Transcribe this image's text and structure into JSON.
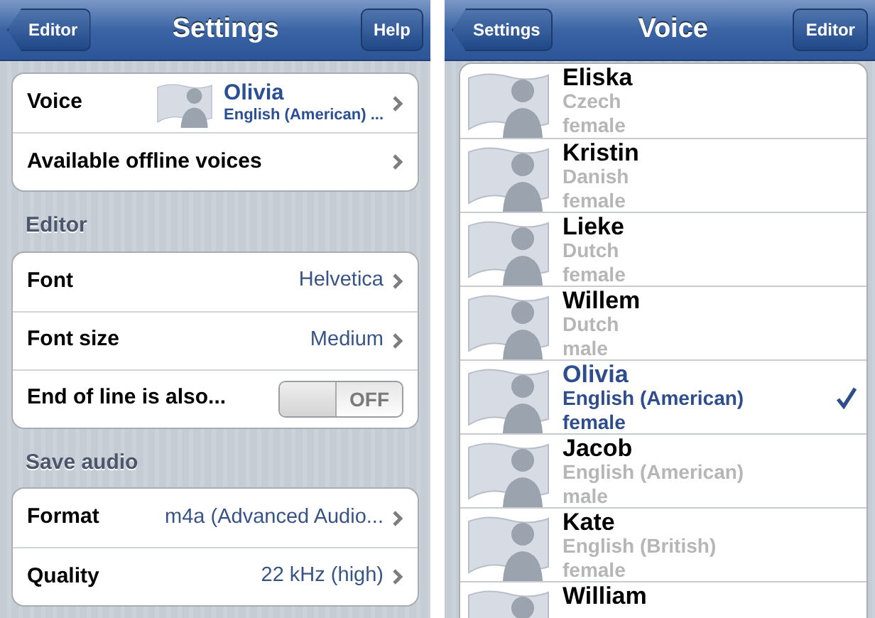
{
  "settings_screen": {
    "nav": {
      "back": "Editor",
      "title": "Settings",
      "action": "Help"
    },
    "groups": [
      {
        "rows": [
          {
            "kind": "voice",
            "label": "Voice",
            "voice_name": "Olivia",
            "voice_language": "English (American) ..."
          },
          {
            "kind": "link",
            "label": "Available offline voices"
          }
        ]
      },
      {
        "header": "Editor",
        "rows": [
          {
            "kind": "value",
            "label": "Font",
            "value": "Helvetica"
          },
          {
            "kind": "value",
            "label": "Font size",
            "value": "Medium"
          },
          {
            "kind": "toggle",
            "label": "End of line is also...",
            "on": false,
            "state_text": "OFF"
          }
        ]
      },
      {
        "header": "Save audio",
        "rows": [
          {
            "kind": "value",
            "label": "Format",
            "value": "m4a (Advanced Audio..."
          },
          {
            "kind": "value",
            "label": "Quality",
            "value": "22 kHz (high)"
          }
        ]
      }
    ]
  },
  "voice_screen": {
    "nav": {
      "back": "Settings",
      "title": "Voice",
      "action": "Editor"
    },
    "voices": [
      {
        "name": "Eliska",
        "language": "Czech",
        "gender": "female",
        "selected": false
      },
      {
        "name": "Kristin",
        "language": "Danish",
        "gender": "female",
        "selected": false
      },
      {
        "name": "Lieke",
        "language": "Dutch",
        "gender": "female",
        "selected": false
      },
      {
        "name": "Willem",
        "language": "Dutch",
        "gender": "male",
        "selected": false
      },
      {
        "name": "Olivia",
        "language": "English (American)",
        "gender": "female",
        "selected": true
      },
      {
        "name": "Jacob",
        "language": "English (American)",
        "gender": "male",
        "selected": false
      },
      {
        "name": "Kate",
        "language": "English (British)",
        "gender": "female",
        "selected": false
      },
      {
        "name": "William",
        "selected": false
      }
    ]
  }
}
